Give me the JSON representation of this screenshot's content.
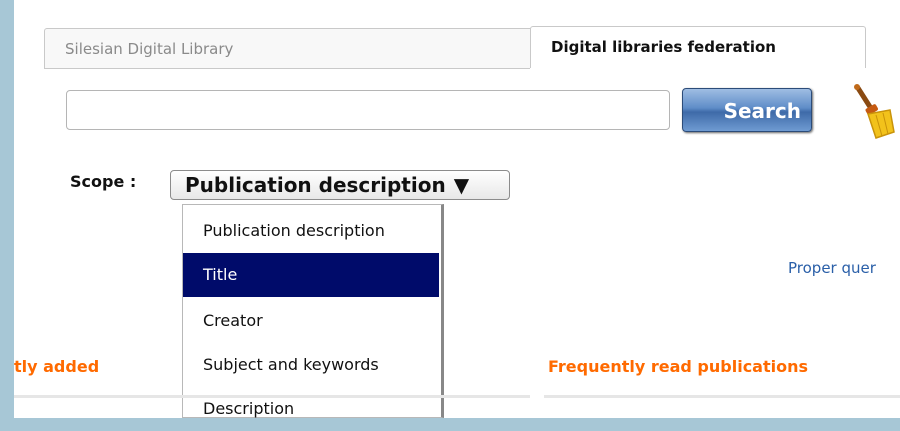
{
  "tabs": [
    {
      "label": "Silesian Digital Library",
      "active": false
    },
    {
      "label": "Digital libraries federation",
      "active": true
    }
  ],
  "search": {
    "value": "",
    "placeholder": "",
    "button_label": "Search"
  },
  "scope": {
    "label": "Scope :",
    "selected": "Publication description",
    "arrow": "▼",
    "options": [
      "Publication description",
      "Title",
      "Creator",
      "Subject and keywords",
      "Description"
    ],
    "highlighted_index": 1
  },
  "links": {
    "proper_query": "Proper quer"
  },
  "sections": {
    "recently_added": "tly added",
    "frequently_read": "Frequently read publications"
  },
  "colors": {
    "background": "#a7c7d6",
    "accent_heading": "#ff6a00",
    "selection": "#000b6a",
    "link": "#2a5fa8"
  },
  "icons": {
    "clear": "broom-icon"
  }
}
